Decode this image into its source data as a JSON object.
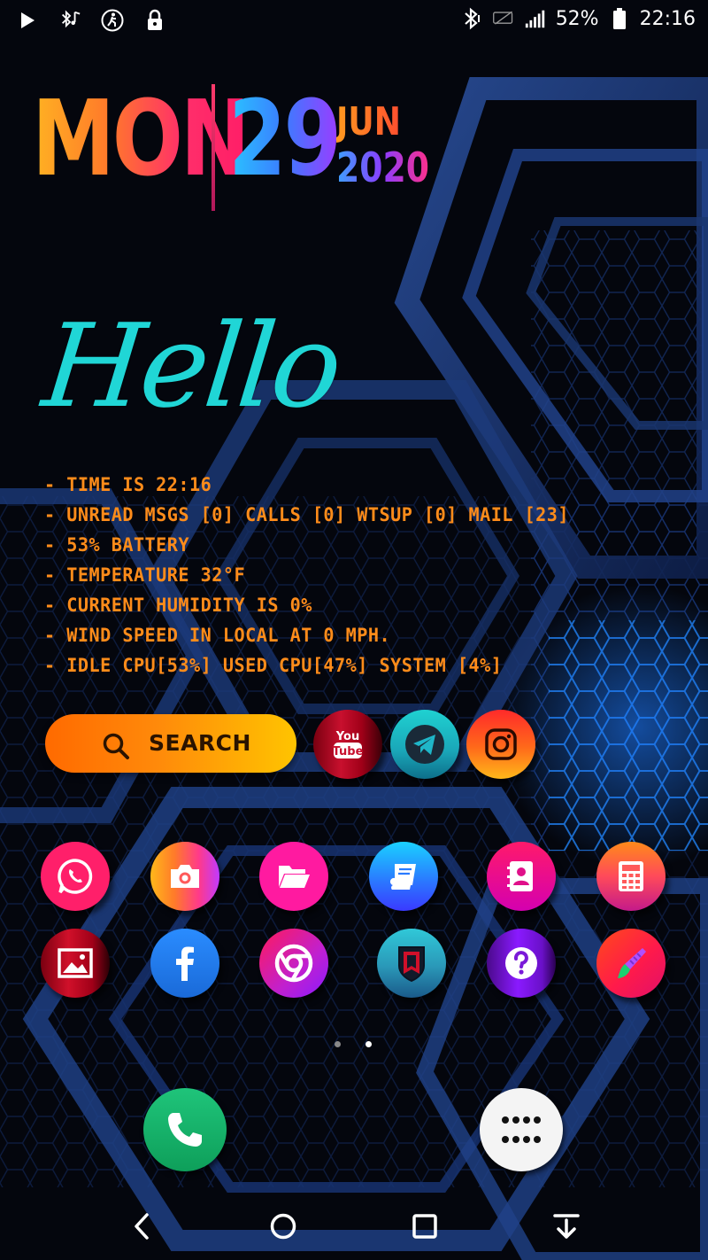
{
  "status_bar": {
    "battery_percent": "52%",
    "time": "22:16",
    "left_icons": [
      "play-icon",
      "bluetooth-music-icon",
      "accessibility-icon",
      "lock-icon"
    ],
    "right_icons": [
      "bluetooth-icon",
      "no-sim-icon",
      "signal-icon",
      "battery-icon"
    ]
  },
  "date_widget": {
    "day": "MON",
    "date": "29",
    "month": "JUN",
    "year": "2020"
  },
  "greeting": "Hello",
  "info_lines": [
    "- TIME IS 22:16",
    "- UNREAD MSGS [0] CALLS [0] WTSUP [0] MAIL [23]",
    "- 53% BATTERY",
    "- TEMPERATURE 32°F",
    "- CURRENT HUMIDITY IS 0%",
    "- WIND SPEED IN LOCAL AT 0 MPH.",
    "- IDLE CPU[53%] USED CPU[47%] SYSTEM [4%]"
  ],
  "search": {
    "label": "SEARCH"
  },
  "top_apps": [
    {
      "name": "youtube-icon",
      "label_line1": "You",
      "label_line2": "Tube",
      "color": "#c8102e"
    },
    {
      "name": "telegram-icon",
      "color": "#1fb6c8"
    },
    {
      "name": "instagram-icon",
      "color": "#ff6a1a"
    }
  ],
  "row1_apps": [
    "whatsapp-icon",
    "camera-icon",
    "folder-icon",
    "book-icon",
    "contacts-icon",
    "calculator-icon"
  ],
  "row2_apps": [
    "gallery-icon",
    "facebook-icon",
    "chrome-icon",
    "shield-icon",
    "help-icon",
    "paint-icon"
  ],
  "page_indicator": {
    "count": 2,
    "active": 2
  },
  "dock": [
    "phone-icon",
    "app-drawer-icon"
  ],
  "nav": [
    "back-icon",
    "home-icon",
    "recents-icon",
    "notification-pull-icon"
  ],
  "colors": {
    "accent_orange": "#ff8c1a",
    "hello_teal": "#20d6d6",
    "wallpaper_blue": "#1a3a7a"
  }
}
